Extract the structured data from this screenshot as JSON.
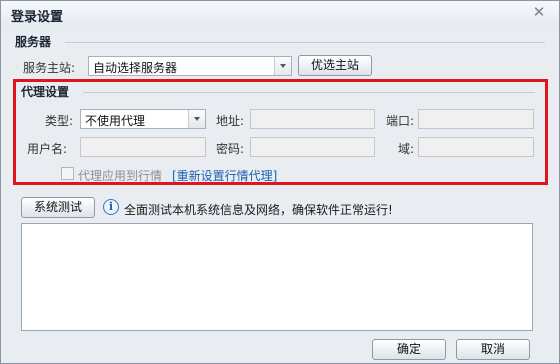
{
  "dialog": {
    "title": "登录设置",
    "close_icon": "close-icon"
  },
  "server": {
    "section_title": "服务器",
    "host_label": "服务主站:",
    "host_value": "自动选择服务器",
    "select_best_button": "优选主站"
  },
  "proxy": {
    "section_title": "代理设置",
    "type_label": "类型:",
    "type_value": "不使用代理",
    "address_label": "地址:",
    "address_value": "",
    "port_label": "端口:",
    "port_value": "",
    "username_label": "用户名:",
    "username_value": "",
    "password_label": "密码:",
    "password_value": "",
    "domain_label": "域:",
    "domain_value": "",
    "apply_to_quotes_label": "代理应用到行情",
    "apply_to_quotes_checked": false,
    "reset_quotes_proxy_link": "[重新设置行情代理]",
    "highlight_color": "#e0141b"
  },
  "system_test": {
    "button": "系统测试",
    "info_icon": "info-icon",
    "info_text": "全面测试本机系统信息及网络，确保软件正常运行!",
    "output": ""
  },
  "footer": {
    "ok_button": "确定",
    "cancel_button": "取消"
  }
}
